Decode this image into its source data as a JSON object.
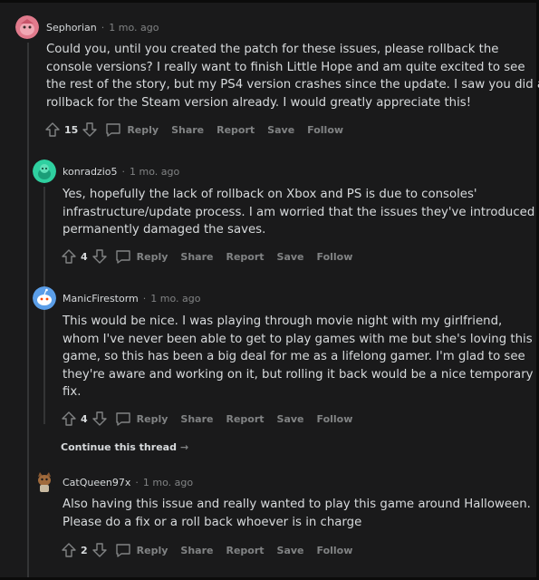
{
  "comments": [
    {
      "author": "Sephorian",
      "sep": "·",
      "time": "1 mo. ago",
      "lines": [
        "Could you, until you created the patch for these issues, please rollback the",
        "console versions? I really want to finish Little Hope and am quite excited to see",
        "the rest of the story, but my PS4 version crashes since the update. I saw you did a",
        "rollback for the Steam version already. I would greatly appreciate this!"
      ],
      "score": "15",
      "avatar_color": "#e07a8c"
    },
    {
      "author": "konradzio5",
      "sep": "·",
      "time": "1 mo. ago",
      "lines": [
        "Yes, hopefully the lack of rollback on Xbox and PS is due to consoles'",
        "infrastructure/update process. I am worried that the issues they've introduced",
        "permanently damaged the saves."
      ],
      "score": "4",
      "avatar_color": "#2fd0a0"
    },
    {
      "author": "ManicFirestorm",
      "sep": "·",
      "time": "1 mo. ago",
      "lines": [
        "This would be nice. I was playing through movie night with my girlfriend,",
        "whom I've never been able to get to play games with me but she's loving this",
        "game, so this has been a big deal for me as a lifelong gamer. I'm glad to see",
        "they're aware and working on it, but rolling it back would be a nice temporary",
        "fix."
      ],
      "score": "4",
      "avatar_color": "#5b9ee8"
    },
    {
      "author": "CatQueen97x",
      "sep": "·",
      "time": "1 mo. ago",
      "lines": [
        "Also having this issue and really wanted to play this game around Halloween.",
        "Please do a fix or a roll back whoever is in charge"
      ],
      "score": "2",
      "avatar_color": "#6b4a2e"
    }
  ],
  "actions": {
    "reply": "Reply",
    "share": "Share",
    "report": "Report",
    "save": "Save",
    "follow": "Follow"
  },
  "continue_thread": {
    "label": "Continue this thread",
    "arrow": "→"
  },
  "icons": {
    "upvote": "upvote-arrow-icon",
    "downvote": "downvote-arrow-icon",
    "comment": "comment-bubble-icon"
  }
}
